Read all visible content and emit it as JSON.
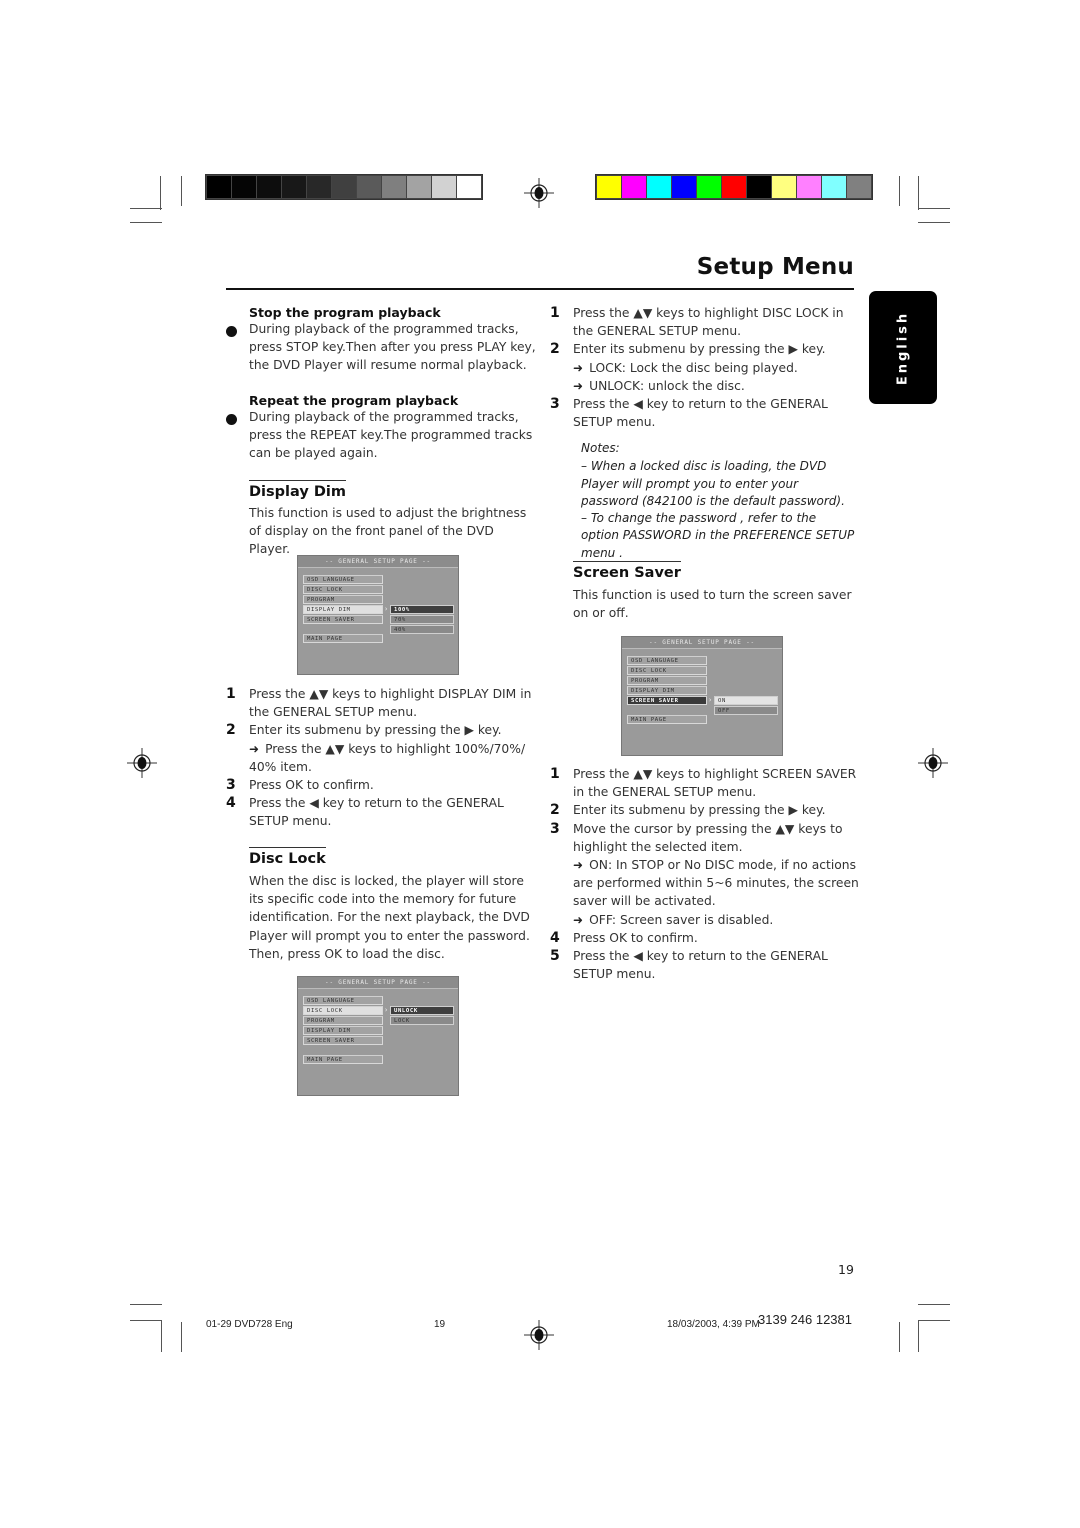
{
  "color_bars": {
    "grayscale": [
      "#000000",
      "#050505",
      "#0d0d0d",
      "#181818",
      "#282828",
      "#404040",
      "#5a5a5a",
      "#7f7f7f",
      "#a3a3a3",
      "#d2d2d2",
      "#ffffff"
    ],
    "colors": [
      "#ffff00",
      "#ff00ff",
      "#00ffff",
      "#0000ff",
      "#00ff00",
      "#ff0000",
      "#000000",
      "#ffff80",
      "#ff80ff",
      "#80ffff",
      "#808080"
    ]
  },
  "header": {
    "title": "Setup Menu",
    "language_tab": "English"
  },
  "left_column": {
    "stop_program": {
      "heading": "Stop the program playback",
      "text": "During playback of the programmed tracks, press STOP key.Then after you press PLAY key, the DVD Player will resume normal playback."
    },
    "repeat_program": {
      "heading": "Repeat the program playback",
      "text": "During playback of the programmed tracks, press the REPEAT key.The programmed tracks can be played again."
    },
    "display_dim": {
      "heading": "Display Dim",
      "intro": "This function is used to adjust the brightness of display on the front panel of the DVD Player.",
      "steps": [
        {
          "num": "1",
          "text": "Press the ▲▼ keys to highlight  DISPLAY DIM in the GENERAL SETUP menu."
        },
        {
          "num": "2",
          "text": "Enter its submenu by pressing the ▶  key."
        },
        {
          "arrow": "➜",
          "text": "Press the ▲▼ keys to highlight 100%/70%/ 40% item."
        },
        {
          "num": "3",
          "text": "Press OK to confirm."
        },
        {
          "num": "4",
          "text": "Press the ◀ key to return to the GENERAL SETUP menu."
        }
      ]
    },
    "disc_lock": {
      "heading": "Disc Lock",
      "intro": "When the disc is locked, the player will store its specific code into the memory for future identification. For the next playback, the DVD Player will prompt you to enter the password. Then, press OK to load the disc."
    }
  },
  "right_column": {
    "disc_lock_steps": [
      {
        "num": "1",
        "text": "Press the ▲▼ keys to highlight DISC LOCK in the GENERAL SETUP menu."
      },
      {
        "num": "2",
        "text": "Enter its submenu by pressing the ▶  key."
      },
      {
        "arrow": "➜",
        "text": "LOCK: Lock the disc being played."
      },
      {
        "arrow": "➜",
        "text": "UNLOCK: unlock the disc."
      },
      {
        "num": "3",
        "text": "Press the ◀ key to return to the GENERAL SETUP menu."
      }
    ],
    "notes": {
      "label": "Notes:",
      "items": [
        "–   When a locked disc is loading, the DVD Player will prompt you to enter your password (842100 is the default password).",
        "–   To change the password , refer to the option PASSWORD in the PREFERENCE SETUP menu ."
      ]
    },
    "screen_saver": {
      "heading": "Screen Saver",
      "intro": "This function is used to turn the screen saver on or off.",
      "steps": [
        {
          "num": "1",
          "text": "Press the ▲▼ keys to highlight SCREEN SAVER in the GENERAL SETUP menu."
        },
        {
          "num": "2",
          "text": "Enter its submenu by pressing the ▶ key."
        },
        {
          "num": "3",
          "text": "Move the cursor by pressing the ▲▼ keys to highlight the selected item."
        },
        {
          "arrow": "➜",
          "text": "ON: In STOP or No DISC mode, if no actions are performed within 5~6 minutes, the screen saver will be activated."
        },
        {
          "arrow": "➜",
          "text": "OFF: Screen saver is disabled."
        },
        {
          "num": "4",
          "text": "Press OK to confirm."
        },
        {
          "num": "5",
          "text": "Press the ◀ key to return to the GENERAL SETUP menu."
        }
      ]
    }
  },
  "osd_menus": {
    "title": "-- GENERAL SETUP PAGE --",
    "items": [
      "OSD LANGUAGE",
      "DISC LOCK",
      "PROGRAM",
      "DISPLAY DIM",
      "SCREEN SAVER",
      "MAIN PAGE"
    ],
    "display_dim": {
      "highlighted": "DISPLAY DIM",
      "options": [
        "100%",
        "70%",
        "40%"
      ],
      "selected": "100%"
    },
    "disc_lock": {
      "highlighted": "DISC LOCK",
      "options": [
        "UNLOCK",
        "LOCK"
      ],
      "selected": "UNLOCK"
    },
    "screen_saver": {
      "highlighted": "SCREEN SAVER",
      "options": [
        "ON",
        "OFF"
      ],
      "selected": "ON"
    }
  },
  "footer": {
    "page_number": "19",
    "file_name": "01-29 DVD728 Eng",
    "file_page": "19",
    "timestamp": "18/03/2003, 4:39 PM",
    "part_number": "3139 246 12381"
  }
}
